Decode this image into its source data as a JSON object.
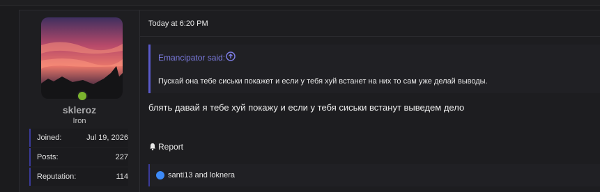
{
  "post": {
    "user": {
      "username": "skleroz",
      "title": "Iron",
      "online_color": "#7bb32e",
      "stats": [
        {
          "label": "Joined:",
          "value": "Jul 19, 2026"
        },
        {
          "label": "Posts:",
          "value": "227"
        },
        {
          "label": "Reputation:",
          "value": "114"
        }
      ]
    },
    "timestamp": "Today at 6:20 PM",
    "quote": {
      "author_said": "Emancipator said:",
      "text": "Пускай она тебе сиськи покажет и если у тебя хуй встанет на них то сам уже делай выводы."
    },
    "body": "блять давай я тебе хуй покажу и если у тебя сиськи встанут выведем дело",
    "report_label": "Report",
    "reactions": {
      "icon": "thumbs-up-icon",
      "text": "santi13 and loknera"
    }
  }
}
